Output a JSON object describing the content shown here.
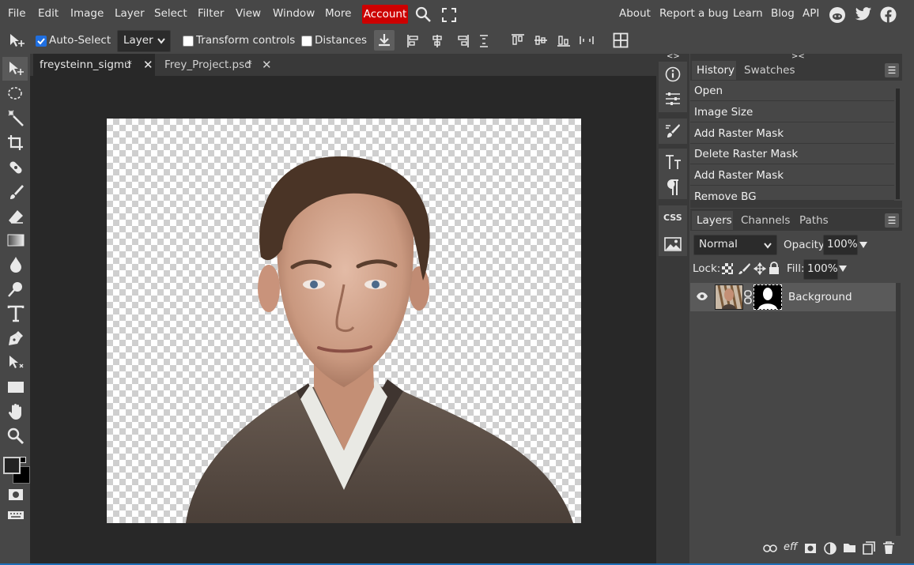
{
  "menu": {
    "items": [
      "File",
      "Edit",
      "Image",
      "Layer",
      "Select",
      "Filter",
      "View",
      "Window",
      "More"
    ],
    "account_label": "Account",
    "right_links": [
      "About",
      "Report a bug",
      "Learn",
      "Blog",
      "API"
    ],
    "colors": {
      "account_bg": "#cc0000"
    }
  },
  "options": {
    "auto_select_label": "Auto-Select",
    "auto_select_checked": true,
    "layer_select_value": "Layer",
    "transform_controls_label": "Transform controls",
    "distances_label": "Distances"
  },
  "tools": [
    "move-tool",
    "marquee-tool",
    "magic-wand-tool",
    "crop-tool",
    "healing-tool",
    "brush-tool",
    "eraser-tool",
    "gradient-tool",
    "blur-tool",
    "dodge-tool",
    "type-tool",
    "pen-tool",
    "direct-select-tool",
    "shape-tool",
    "hand-tool",
    "zoom-tool"
  ],
  "tabs": [
    {
      "label": "freysteinn_sigmu",
      "modified": "*",
      "active": true
    },
    {
      "label": "Frey_Project.psd",
      "modified": "*",
      "active": false
    }
  ],
  "mini_panel": {
    "collapse_left": "<>",
    "collapse_right": "><",
    "css_label": "CSS"
  },
  "history": {
    "tabs": [
      "History",
      "Swatches"
    ],
    "items": [
      "Open",
      "Image Size",
      "Add Raster Mask",
      "Delete Raster Mask",
      "Add Raster Mask",
      "Remove BG"
    ]
  },
  "layers": {
    "tabs": [
      "Layers",
      "Channels",
      "Paths"
    ],
    "blend_mode": "Normal",
    "opacity_label": "Opacity:",
    "opacity_value": "100%",
    "lock_label": "Lock:",
    "fill_label": "Fill:",
    "fill_value": "100%",
    "items": [
      {
        "name": "Background",
        "visible": true
      }
    ],
    "footer_effects_label": "eff"
  }
}
